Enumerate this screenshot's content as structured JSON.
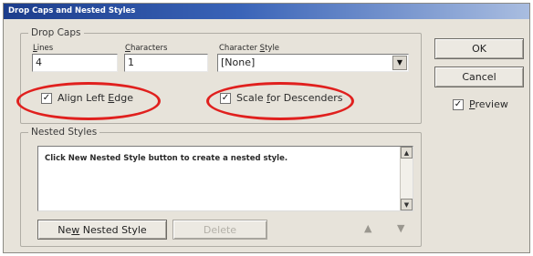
{
  "window": {
    "title": "Drop Caps and Nested Styles"
  },
  "drop_caps": {
    "legend": "Drop Caps",
    "lines_label": "Lines",
    "lines_value": "4",
    "characters_label": "Characters",
    "characters_value": "1",
    "character_style_label": "Character Style",
    "character_style_value": "[None]",
    "align_left_edge_label": "Align Left Edge",
    "align_left_edge_checked": true,
    "scale_for_descenders_label": "Scale for Descenders",
    "scale_for_descenders_checked": true
  },
  "nested_styles": {
    "legend": "Nested Styles",
    "message": "Click New Nested Style button to create a nested style.",
    "new_button_label": "New Nested Style",
    "delete_button_label": "Delete"
  },
  "buttons": {
    "ok": "OK",
    "cancel": "Cancel"
  },
  "preview": {
    "label": "Preview",
    "checked": true
  },
  "icons": {
    "checkmark": "✓",
    "dropdown": "▼",
    "up": "▲",
    "down": "▼"
  },
  "colors": {
    "title_bar": "#1c3d8c",
    "highlight_oval": "#e0201e"
  }
}
